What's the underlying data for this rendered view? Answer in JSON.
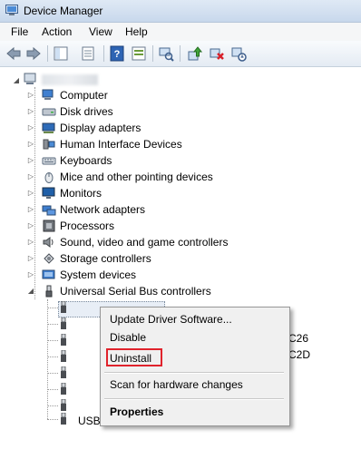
{
  "window": {
    "title": "Device Manager"
  },
  "menubar": {
    "items": [
      "File",
      "Action",
      "View",
      "Help"
    ]
  },
  "tree": {
    "categories": [
      "Computer",
      "Disk drives",
      "Display adapters",
      "Human Interface Devices",
      "Keyboards",
      "Mice and other pointing devices",
      "Monitors",
      "Network adapters",
      "Processors",
      "Sound, video and game controllers",
      "Storage controllers",
      "System devices",
      "Universal Serial Bus controllers"
    ],
    "usb_partial_1": "C26",
    "usb_partial_2": "C2D",
    "usb_last": "USB Root Hub"
  },
  "context_menu": {
    "update": "Update Driver Software...",
    "disable": "Disable",
    "uninstall": "Uninstall",
    "scan": "Scan for hardware changes",
    "properties": "Properties"
  },
  "colors": {
    "highlight": "#e0232c",
    "accent": "#1f5fa8"
  }
}
